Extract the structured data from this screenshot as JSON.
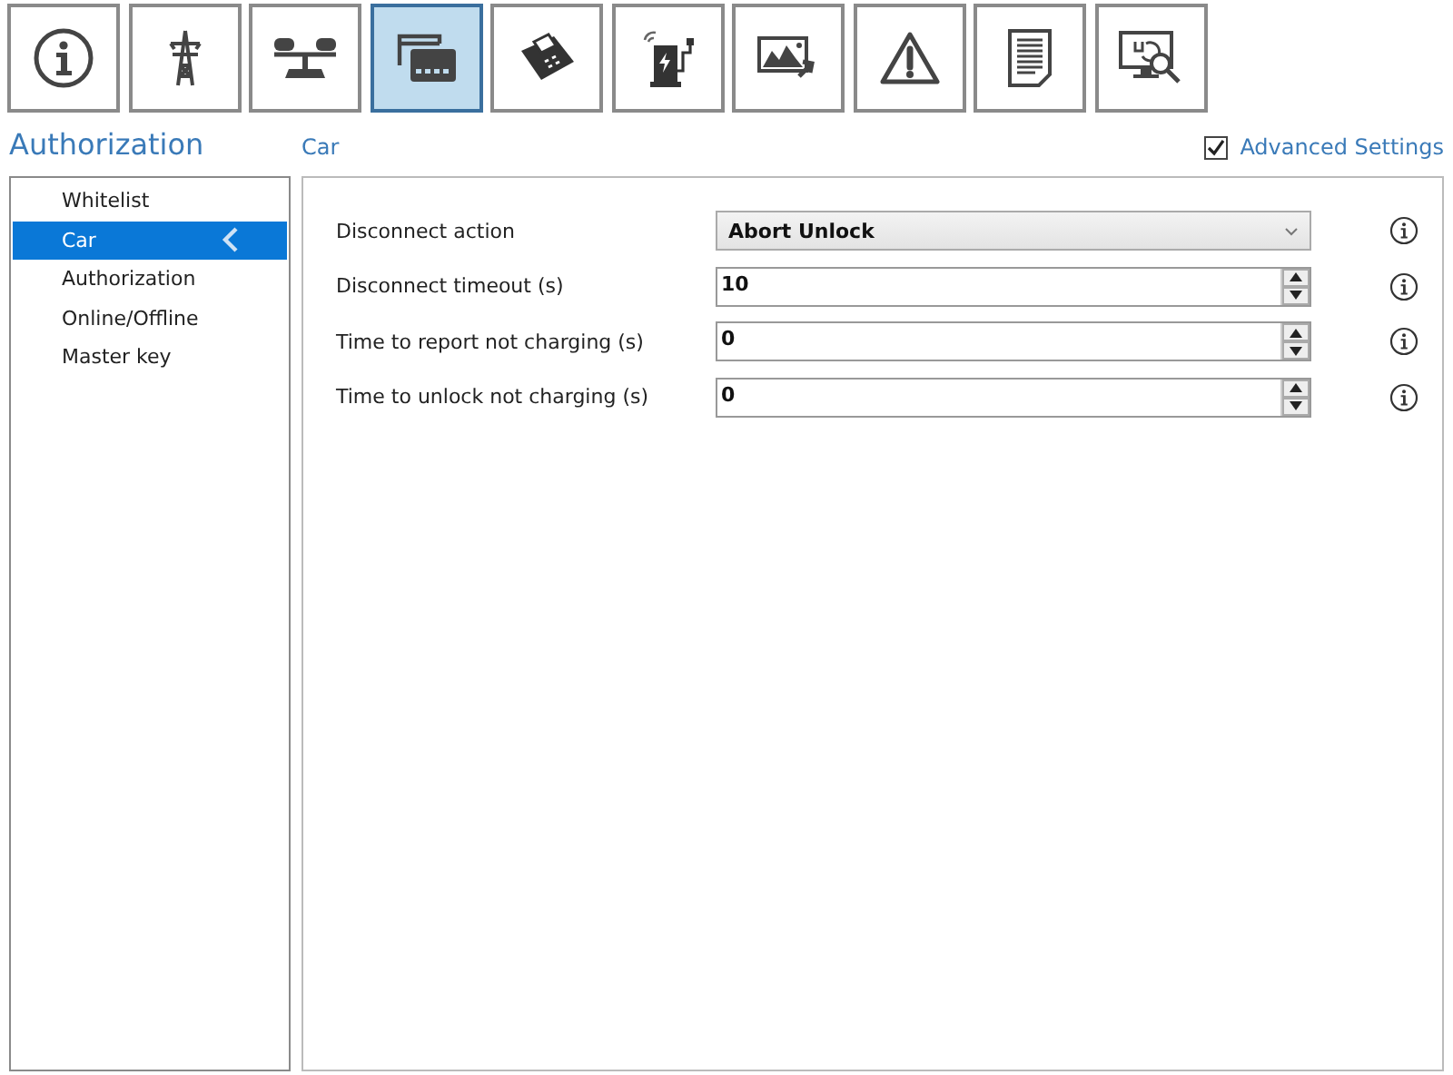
{
  "toolbar": [
    {
      "kind": "info",
      "selected": false
    },
    {
      "kind": "pylon",
      "selected": false
    },
    {
      "kind": "scale",
      "selected": false
    },
    {
      "kind": "cards",
      "selected": true
    },
    {
      "kind": "terminal",
      "selected": false
    },
    {
      "kind": "charger",
      "selected": false
    },
    {
      "kind": "image",
      "selected": false
    },
    {
      "kind": "warning",
      "selected": false
    },
    {
      "kind": "document",
      "selected": false
    },
    {
      "kind": "monitor",
      "selected": false
    }
  ],
  "section_title": "Authorization",
  "page_title": "Car",
  "advanced_settings": {
    "label": "Advanced Settings",
    "checked": true
  },
  "sidebar": {
    "items": [
      {
        "label": "Whitelist",
        "selected": false
      },
      {
        "label": "Car",
        "selected": true
      },
      {
        "label": "Authorization",
        "selected": false
      },
      {
        "label": "Online/Offline",
        "selected": false
      },
      {
        "label": "Master key",
        "selected": false
      }
    ]
  },
  "settings": [
    {
      "label": "Disconnect action",
      "kind": "dropdown",
      "value": "Abort Unlock"
    },
    {
      "label": "Disconnect timeout (s)",
      "kind": "spinner",
      "value": "10"
    },
    {
      "label": "Time to report not charging (s)",
      "kind": "spinner",
      "value": "0"
    },
    {
      "label": "Time to unlock not charging (s)",
      "kind": "spinner",
      "value": "0"
    }
  ]
}
